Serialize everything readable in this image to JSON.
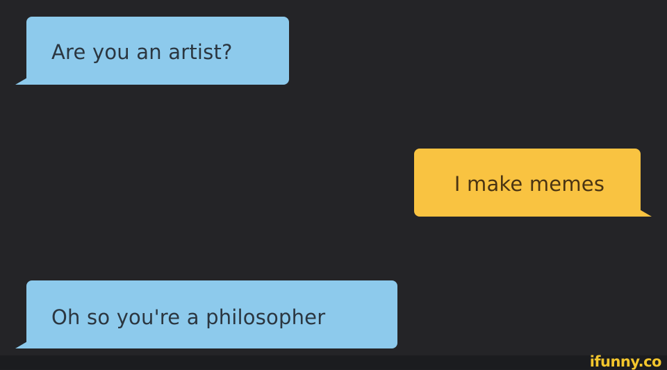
{
  "conversation": {
    "messages": [
      {
        "sender": "them",
        "text": "Are you an artist?",
        "color": "#8dcaec"
      },
      {
        "sender": "me",
        "text": "I make memes",
        "color": "#f9c341"
      },
      {
        "sender": "them",
        "text": "Oh so you're a philosopher",
        "color": "#8dcaec"
      }
    ]
  },
  "watermark": {
    "text": "ifunny.co",
    "color": "#f3c62d"
  },
  "background_color": "#242427"
}
